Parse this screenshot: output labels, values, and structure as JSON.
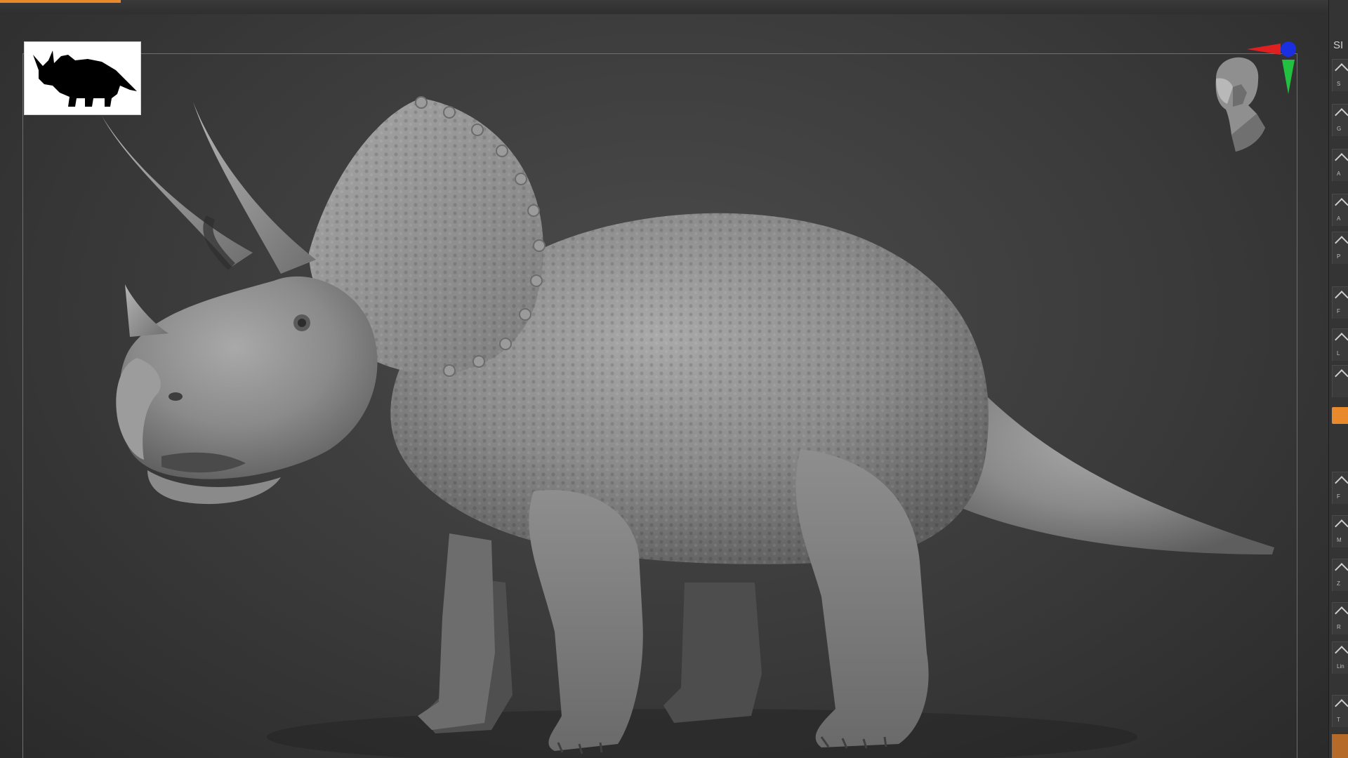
{
  "viewport": {
    "name": "3D sculpt viewport",
    "model_subject": "triceratops",
    "thumbnail_icon": "triceratops-silhouette-icon",
    "navigator_icon": "head-navigator-icon",
    "axis_colors": {
      "x": "#e02020",
      "y": "#22c040",
      "z": "#1a2fe0"
    }
  },
  "shelf": {
    "top_label": "SI",
    "buttons": [
      {
        "icon": "arrow-up-icon",
        "mini": "S"
      },
      {
        "icon": "arrow-up-icon",
        "mini": "G"
      },
      {
        "icon": "arrow-up-icon",
        "mini": "A"
      },
      {
        "icon": "arrow-up-icon",
        "mini": "A"
      },
      {
        "icon": "arrow-up-icon",
        "mini": "P"
      },
      {
        "icon": "arrow-up-icon",
        "mini": "F"
      },
      {
        "icon": "arrow-up-icon",
        "mini": "L"
      },
      {
        "icon": "arrow-up-icon",
        "mini": ""
      },
      {
        "icon": "arrow-up-icon",
        "mini": "F"
      },
      {
        "icon": "arrow-up-icon",
        "mini": "M"
      },
      {
        "icon": "arrow-up-icon",
        "mini": "Z"
      },
      {
        "icon": "arrow-up-icon",
        "mini": "R"
      },
      {
        "icon": "arrow-up-icon",
        "mini": "Lin"
      },
      {
        "icon": "arrow-up-icon",
        "mini": "T"
      }
    ],
    "accent_color": "#e8892c"
  }
}
